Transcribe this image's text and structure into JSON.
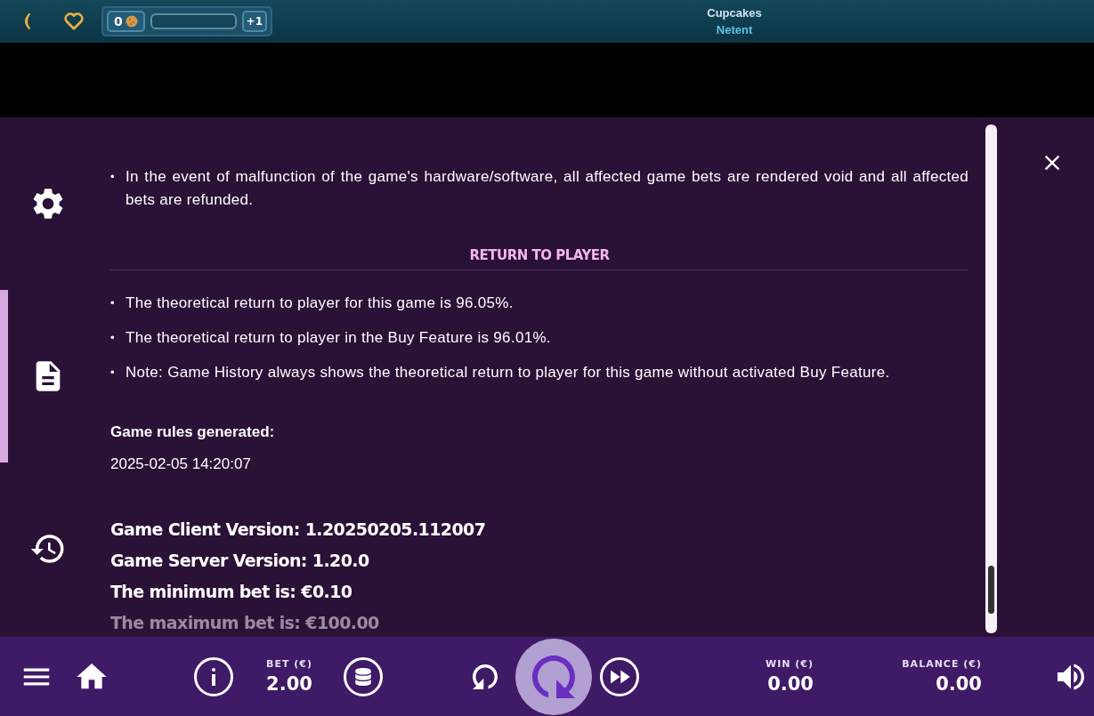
{
  "top_bar": {
    "coins": "0",
    "bonus": "+1",
    "title": "Cupcakes",
    "provider": "Netent"
  },
  "sidebar": {
    "items": [
      {
        "kind": "settings",
        "selected": false
      },
      {
        "kind": "rules",
        "selected": true
      },
      {
        "kind": "history",
        "selected": false
      }
    ]
  },
  "rules": {
    "bullet": "•",
    "bullets_top": [
      "In the event of malfunction of the game's hardware/software, all affected game bets are rendered void and all affected bets are refunded."
    ],
    "section_title": "RETURN TO PLAYER",
    "bullets_rtp": [
      "The theoretical return to player for this game is 96.05%.",
      "The theoretical return to player in the Buy Feature is 96.01%.",
      "Note: Game History always shows the theoretical return to player for this game without activated Buy Feature."
    ],
    "generated_label": "Game rules generated:",
    "generated_value": "2025-02-05 14:20:07",
    "info_lines": [
      {
        "text": "Game Client Version: 1.20250205.112007",
        "faded": false
      },
      {
        "text": "Game Server Version: 1.20.0",
        "faded": false
      },
      {
        "text": "The minimum bet is: €0.10",
        "faded": false
      },
      {
        "text": "The maximum bet is: €100.00",
        "faded": true
      }
    ]
  },
  "bottom_bar": {
    "bet_label": "BET (€)",
    "bet_value": "2.00",
    "win_label": "WIN (€)",
    "win_value": "0.00",
    "balance_label": "BALANCE (€)",
    "balance_value": "0.00"
  }
}
